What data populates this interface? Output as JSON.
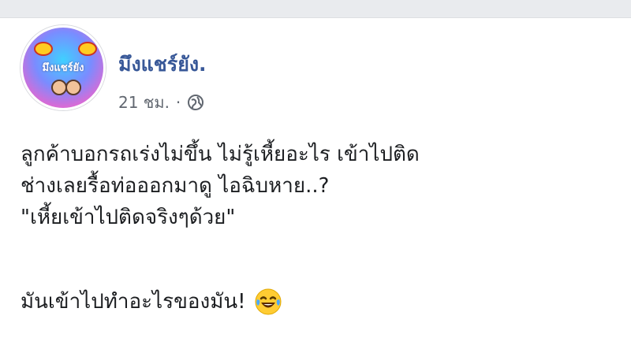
{
  "post": {
    "page_name": "มึงแชร์ยัง.",
    "time": "21 ชม.",
    "separator": "·",
    "privacy_icon": "globe-icon",
    "avatar_text": "มึงแชร์ยัง",
    "lines": [
      "ลูกค้าบอกรถเร่งไม่ขึ้น ไม่รู้เหี้ยอะไร เข้าไปติด",
      "ช่างเลยรื้อท่อออกมาดู ไอฉิบหาย..?",
      "\"เหี้ยเข้าไปติดจริงๆด้วย\""
    ],
    "last_line": "มันเข้าไปทำอะไรของมัน!",
    "emoji": "laughing-tears-emoji",
    "colors": {
      "page_name": "#385898",
      "meta": "#616770",
      "text": "#1c1e21",
      "background": "#e9ebee"
    }
  }
}
